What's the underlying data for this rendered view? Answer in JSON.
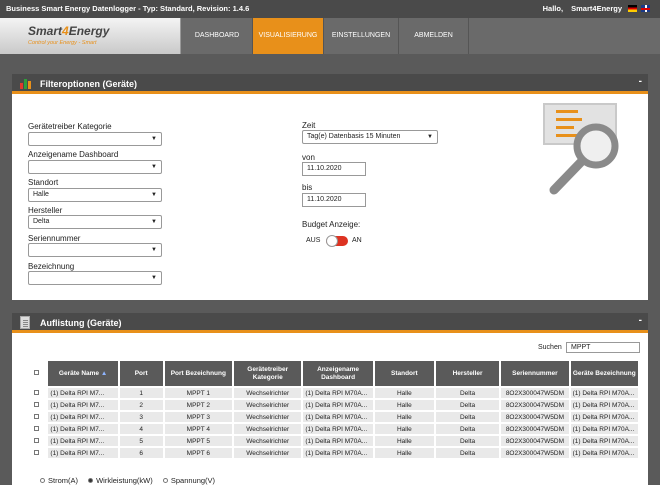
{
  "topbar": {
    "title": "Business Smart Energy Datenlogger - Typ: Standard, Revision: 1.4.6",
    "hello": "Hallo,",
    "user": "Smart4Energy"
  },
  "logo": {
    "brand_a": "Smart",
    "brand_b": "4",
    "brand_c": "Energy",
    "tagline": "Control your Energy - Smart"
  },
  "nav": {
    "items": [
      {
        "label": "DASHBOARD"
      },
      {
        "label": "VISUALISIERUNG"
      },
      {
        "label": "EINSTELLUNGEN"
      },
      {
        "label": "ABMELDEN"
      }
    ],
    "active_index": 1
  },
  "filter": {
    "title": "Filteroptionen (Geräte)",
    "collapse": "-",
    "fields": [
      {
        "label": "Gerätetreiber Kategorie",
        "value": ""
      },
      {
        "label": "Anzeigename Dashboard",
        "value": ""
      },
      {
        "label": "Standort",
        "value": "Halle"
      },
      {
        "label": "Hersteller",
        "value": "Delta"
      },
      {
        "label": "Seriennummer",
        "value": ""
      },
      {
        "label": "Bezeichnung",
        "value": ""
      }
    ],
    "zeit_label": "Zeit",
    "zeit_value": "Tag(e) Datenbasis 15 Minuten",
    "von_label": "von",
    "von_value": "11.10.2020",
    "bis_label": "bis",
    "bis_value": "11.10.2020",
    "budget_label": "Budget Anzeige:",
    "aus": "AUS",
    "an": "AN"
  },
  "listing": {
    "title": "Auflistung (Geräte)",
    "collapse": "-",
    "search_label": "Suchen",
    "search_value": "MPPT",
    "columns": [
      "Geräte Name",
      "Port",
      "Port Bezeichnung",
      "Gerätetreiber Kategorie",
      "Anzeigename Dashboard",
      "Standort",
      "Hersteller",
      "Seriennummer",
      "Geräte Bezeichnung"
    ],
    "sort_indicator": "▲",
    "rows": [
      [
        "(1) Delta RPI M7...",
        "1",
        "MPPT 1",
        "Wechselrichter",
        "(1) Delta RPI M70A...",
        "Halle",
        "Delta",
        "8O2X300047W5DM",
        "(1) Delta RPI M70A..."
      ],
      [
        "(1) Delta RPI M7...",
        "2",
        "MPPT 2",
        "Wechselrichter",
        "(1) Delta RPI M70A...",
        "Halle",
        "Delta",
        "8O2X300047W5DM",
        "(1) Delta RPI M70A..."
      ],
      [
        "(1) Delta RPI M7...",
        "3",
        "MPPT 3",
        "Wechselrichter",
        "(1) Delta RPI M70A...",
        "Halle",
        "Delta",
        "8O2X300047W5DM",
        "(1) Delta RPI M70A..."
      ],
      [
        "(1) Delta RPI M7...",
        "4",
        "MPPT 4",
        "Wechselrichter",
        "(1) Delta RPI M70A...",
        "Halle",
        "Delta",
        "8O2X300047W5DM",
        "(1) Delta RPI M70A..."
      ],
      [
        "(1) Delta RPI M7...",
        "5",
        "MPPT 5",
        "Wechselrichter",
        "(1) Delta RPI M70A...",
        "Halle",
        "Delta",
        "8O2X300047W5DM",
        "(1) Delta RPI M70A..."
      ],
      [
        "(1) Delta RPI M7...",
        "6",
        "MPPT 6",
        "Wechselrichter",
        "(1) Delta RPI M70A...",
        "Halle",
        "Delta",
        "8O2X300047W5DM",
        "(1) Delta RPI M70A..."
      ]
    ]
  },
  "measure_options": {
    "items": [
      "Strom(A)",
      "Wirkleistung(kW)",
      "Spannung(V)"
    ],
    "selected_index": 1
  },
  "colors": {
    "accent": "#e8901a",
    "header_bg": "#4a4a4a",
    "toggle_off": "#dd3322"
  },
  "icons": {
    "filter_panel": "bar-chart-icon",
    "list_panel": "document-icon",
    "filter_illustration": "magnifier-icon",
    "dropdown": "chevron-down-icon"
  }
}
